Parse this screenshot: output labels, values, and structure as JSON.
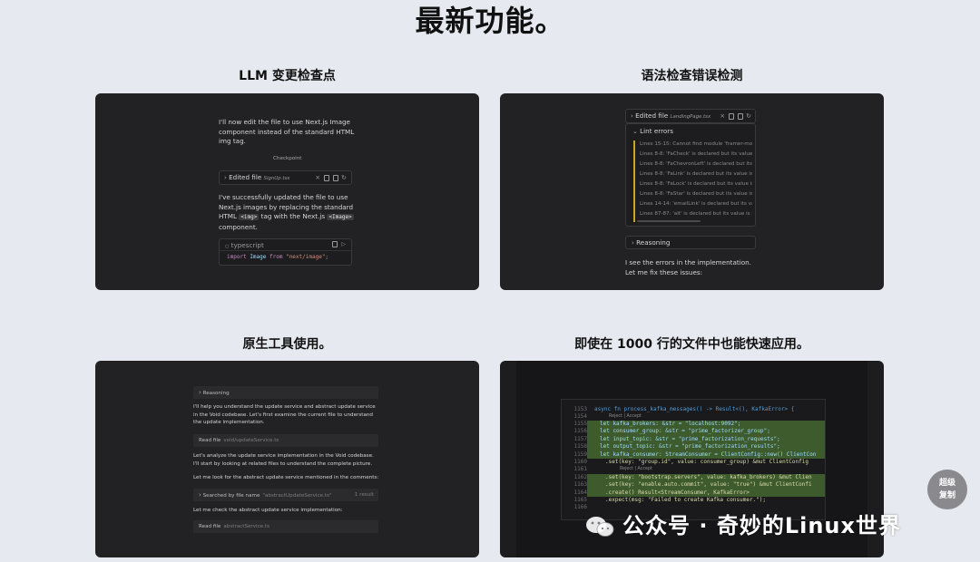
{
  "page_title": "最新功能。",
  "cards": [
    {
      "title": "LLM 变更检查点",
      "intro": "I'll now edit the file to use Next.js Image component instead of the standard HTML img tag.",
      "checkpoint": "Checkpoint",
      "edited_label": "Edited file",
      "edited_file": "SignUp.tsx",
      "body_1": "I've successfully updated the file to use Next.js images by replacing the standard HTML",
      "code_a": "<img>",
      "body_2": "tag with the Next.js",
      "code_b": "<Image>",
      "body_3": "component.",
      "lang": "typescript",
      "code_import": "import",
      "code_name": "Image",
      "code_from": "from",
      "code_path": "\"next/image\";"
    },
    {
      "title": "语法检查错误检测",
      "edited_label": "Edited file",
      "edited_file": "LandingPage.tsx",
      "lint_title": "Lint errors",
      "lint_items": [
        "Lines 15-15: Cannot find module 'framer-motion'",
        "Lines 8-8: 'FaCheck' is declared but its value is n",
        "Lines 8-8: 'FaChevronLeft' is declared but its val",
        "Lines 8-8: 'FaLink' is declared but its value is nev",
        "Lines 8-8: 'FaLock' is declared but its value is nev",
        "Lines 8-8: 'FaStar' is declared but its value is nev",
        "Lines 14-14: 'emailLink' is declared but its value i",
        "Lines 87-87: 'alt' is declared but its value is neve"
      ],
      "reasoning": "Reasoning",
      "outro": "I see the errors in the implementation. Let me fix these issues:"
    },
    {
      "title": "原生工具使用。",
      "reasoning": "Reasoning",
      "p1": "I'll help you understand the update service and abstract update service in the Void codebase. Let's first examine the current file to understand the update implementation.",
      "read1_label": "Read file",
      "read1_path": "void/updateService.ts",
      "p2": "Let's analyze the update service implementation in the Void codebase. I'll start by looking at related files to understand the complete picture.",
      "p3": "Let me look for the abstract update service mentioned in the comments:",
      "search_label": "Searched by file name",
      "search_query": "\"abstractUpdateService.ts\"",
      "search_count": "1 result",
      "p4": "Let me check the abstract update service implementation:",
      "read2_label": "Read file",
      "read2_path": "abstractService.ts"
    },
    {
      "title": "即使在 1000 行的文件中也能快速应用。",
      "reject_accept": "Reject | Accept",
      "lines": [
        {
          "n": "1153",
          "t": "async fn process_kafka_messages() -> Result<(), KafkaError> {"
        },
        {
          "n": "1154",
          "t": ""
        },
        {
          "n": "1155",
          "t": "let kafka_brokers: &str = \"localhost:9092\";"
        },
        {
          "n": "1156",
          "t": "let consumer_group: &str = \"prime_factorizer_group\";"
        },
        {
          "n": "1157",
          "t": "let input_topic: &str = \"prime_factorization_requests\";"
        },
        {
          "n": "1158",
          "t": "let output_topic: &str = \"prime_factorization_results\";"
        },
        {
          "n": "1159",
          "t": "let kafka_consumer: StreamConsumer = ClientConfig::new() ClientCon"
        },
        {
          "n": "1160",
          "t": ".set(key: \"group.id\", value: consumer_group) &mut ClientConfig"
        },
        {
          "n": "1161",
          "t": ""
        },
        {
          "n": "1162",
          "t": ".set(key: \"bootstrap.servers\", value: kafka_brokers) &mut Clien"
        },
        {
          "n": "1163",
          "t": ".set(key: \"enable.auto.commit\", value: \"true\") &mut ClientConfi"
        },
        {
          "n": "1164",
          "t": ".create() Result<StreamConsumer, KafkaError>"
        },
        {
          "n": "1165",
          "t": ".expect(msg: \"Failed to create Kafka consumer.\");"
        },
        {
          "n": "1166",
          "t": ""
        }
      ]
    }
  ],
  "badge_line1": "超级",
  "badge_line2": "复制",
  "watermark": "公众号 · 奇妙的Linux世界"
}
